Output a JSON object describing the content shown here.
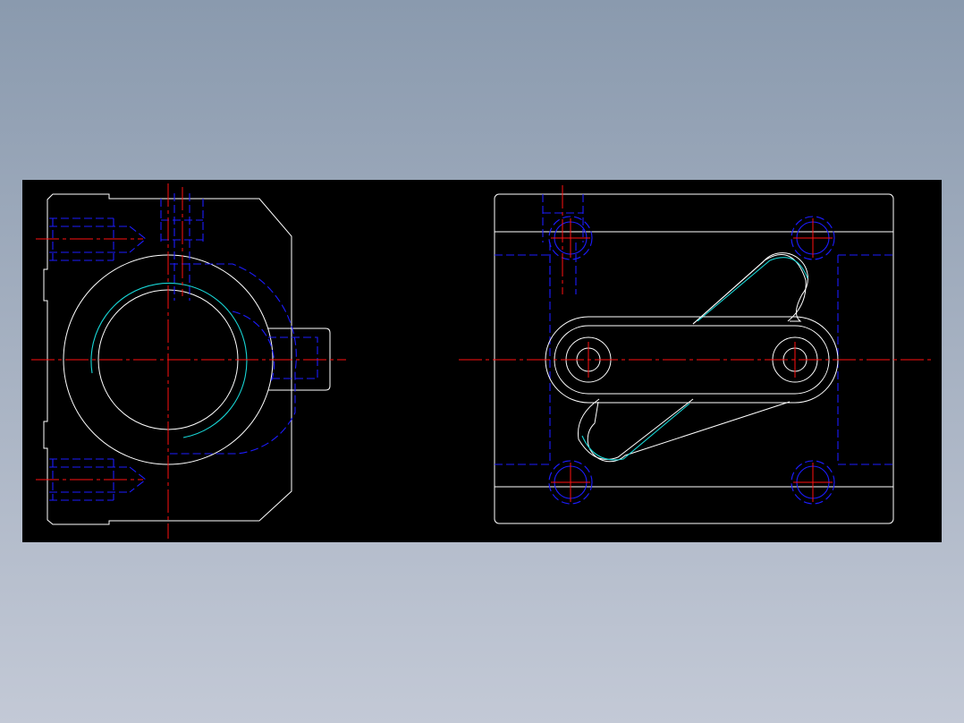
{
  "background": {
    "gradient_top": "#8a9aae",
    "gradient_bottom": "#c3c9d6"
  },
  "viewport": {
    "background_color": "#000000"
  },
  "layer_colors": {
    "outline": "#ffffff",
    "hidden": "#1c1cff",
    "center": "#ff1010",
    "thread": "#18d6d6"
  },
  "views": [
    {
      "name": "front-view",
      "icon": "bearing-housing-front"
    },
    {
      "name": "top-view",
      "icon": "bearing-housing-plate"
    }
  ]
}
